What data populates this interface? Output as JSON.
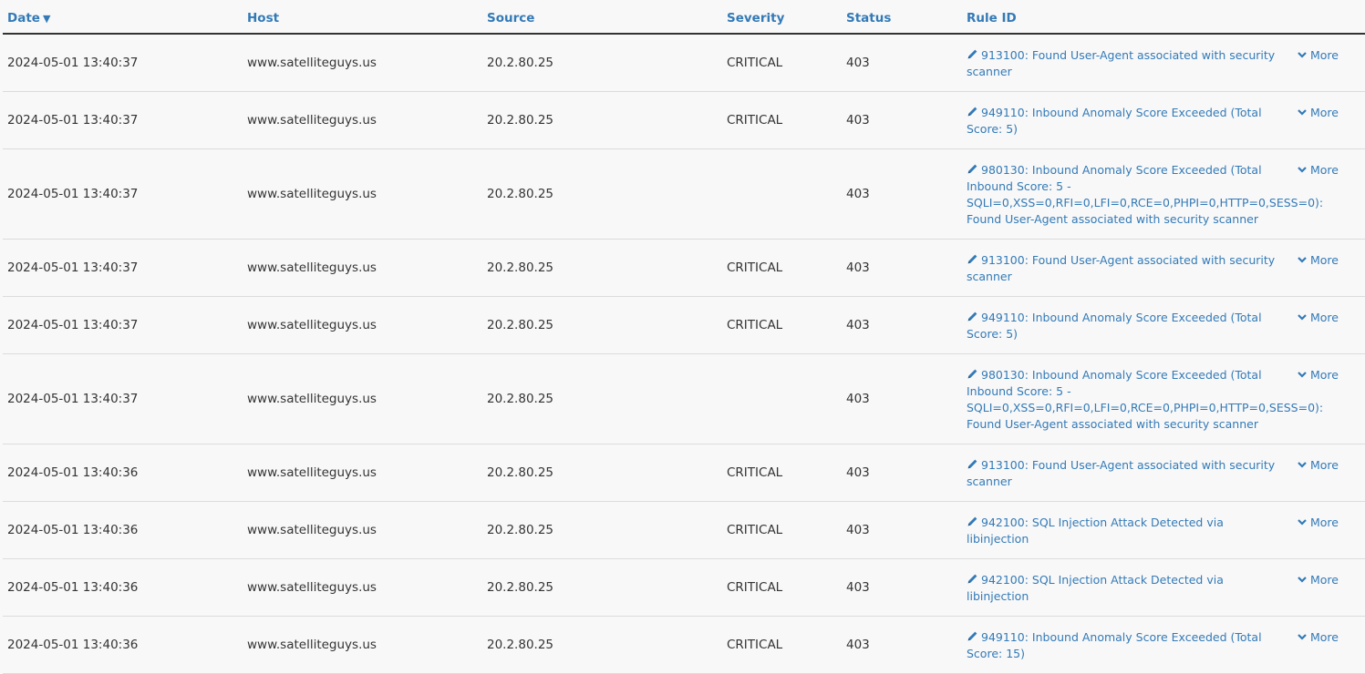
{
  "columns": {
    "date": "Date",
    "sort_indicator": "▼",
    "host": "Host",
    "source": "Source",
    "severity": "Severity",
    "status": "Status",
    "rule_id": "Rule ID"
  },
  "more_label": "More",
  "icons": {
    "edit": "pencil-icon",
    "expand": "chevron-down-icon"
  },
  "accent_color": "#337ab7",
  "rows": [
    {
      "date": "2024-05-01 13:40:37",
      "host": "www.satelliteguys.us",
      "source": "20.2.80.25",
      "severity": "CRITICAL",
      "status": "403",
      "rule": "913100: Found User-Agent associated with security scanner"
    },
    {
      "date": "2024-05-01 13:40:37",
      "host": "www.satelliteguys.us",
      "source": "20.2.80.25",
      "severity": "CRITICAL",
      "status": "403",
      "rule": "949110: Inbound Anomaly Score Exceeded (Total Score: 5)"
    },
    {
      "date": "2024-05-01 13:40:37",
      "host": "www.satelliteguys.us",
      "source": "20.2.80.25",
      "severity": "",
      "status": "403",
      "rule": "980130: Inbound Anomaly Score Exceeded (Total Inbound Score: 5 - SQLI=0,XSS=0,RFI=0,LFI=0,RCE=0,PHPI=0,HTTP=0,SESS=0): Found User-Agent associated with security scanner"
    },
    {
      "date": "2024-05-01 13:40:37",
      "host": "www.satelliteguys.us",
      "source": "20.2.80.25",
      "severity": "CRITICAL",
      "status": "403",
      "rule": "913100: Found User-Agent associated with security scanner"
    },
    {
      "date": "2024-05-01 13:40:37",
      "host": "www.satelliteguys.us",
      "source": "20.2.80.25",
      "severity": "CRITICAL",
      "status": "403",
      "rule": "949110: Inbound Anomaly Score Exceeded (Total Score: 5)"
    },
    {
      "date": "2024-05-01 13:40:37",
      "host": "www.satelliteguys.us",
      "source": "20.2.80.25",
      "severity": "",
      "status": "403",
      "rule": "980130: Inbound Anomaly Score Exceeded (Total Inbound Score: 5 - SQLI=0,XSS=0,RFI=0,LFI=0,RCE=0,PHPI=0,HTTP=0,SESS=0): Found User-Agent associated with security scanner"
    },
    {
      "date": "2024-05-01 13:40:36",
      "host": "www.satelliteguys.us",
      "source": "20.2.80.25",
      "severity": "CRITICAL",
      "status": "403",
      "rule": "913100: Found User-Agent associated with security scanner"
    },
    {
      "date": "2024-05-01 13:40:36",
      "host": "www.satelliteguys.us",
      "source": "20.2.80.25",
      "severity": "CRITICAL",
      "status": "403",
      "rule": "942100: SQL Injection Attack Detected via libinjection"
    },
    {
      "date": "2024-05-01 13:40:36",
      "host": "www.satelliteguys.us",
      "source": "20.2.80.25",
      "severity": "CRITICAL",
      "status": "403",
      "rule": "942100: SQL Injection Attack Detected via libinjection"
    },
    {
      "date": "2024-05-01 13:40:36",
      "host": "www.satelliteguys.us",
      "source": "20.2.80.25",
      "severity": "CRITICAL",
      "status": "403",
      "rule": "949110: Inbound Anomaly Score Exceeded (Total Score: 15)"
    }
  ]
}
